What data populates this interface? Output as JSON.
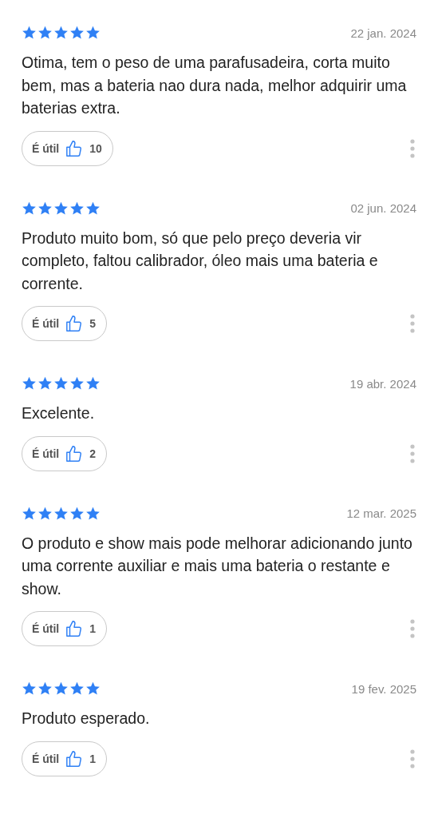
{
  "reviews": [
    {
      "stars": 5,
      "date": "22 jan. 2024",
      "text": "Otima, tem o peso de uma parafusadeira, corta muito bem, mas a bateria nao dura nada, melhor adquirir uma baterias extra.",
      "helpful_label": "É útil",
      "helpful_count": "10"
    },
    {
      "stars": 5,
      "date": "02 jun. 2024",
      "text": "Produto muito bom, só que pelo preço deveria vir completo, faltou calibrador, óleo mais uma bateria e corrente.",
      "helpful_label": "É útil",
      "helpful_count": "5"
    },
    {
      "stars": 5,
      "date": "19 abr. 2024",
      "text": "Excelente.",
      "helpful_label": "É útil",
      "helpful_count": "2"
    },
    {
      "stars": 5,
      "date": "12 mar. 2025",
      "text": "O produto e show mais pode melhorar adicionando junto uma corrente auxiliar e mais uma bateria o restante e show.",
      "helpful_label": "É útil",
      "helpful_count": "1"
    },
    {
      "stars": 5,
      "date": "19 fev. 2025",
      "text": "Produto esperado.",
      "helpful_label": "É útil",
      "helpful_count": "1"
    }
  ]
}
